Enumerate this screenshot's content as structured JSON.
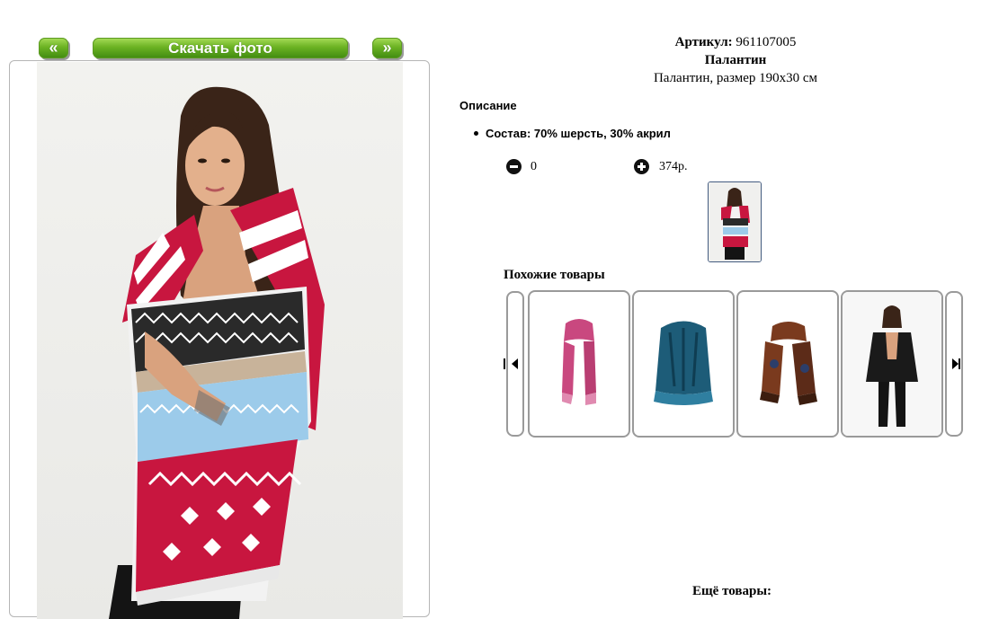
{
  "nav": {
    "prev_label": "«",
    "download_label": "Скачать фото",
    "next_label": "»"
  },
  "product": {
    "article_label": "Артикул:",
    "article_value": "961107005",
    "name": "Палантин",
    "subtitle": "Палантин, размер 190x30 см"
  },
  "description": {
    "title": "Описание",
    "items": [
      "Состав: 70% шерсть, 30% акрил"
    ]
  },
  "cart": {
    "quantity": "0",
    "price": "374р."
  },
  "similar": {
    "title": "Похожие товары",
    "items": [
      {
        "icon": "pink-scarf-image",
        "color": "#c9487f"
      },
      {
        "icon": "teal-scarf-image",
        "color": "#1d5c78"
      },
      {
        "icon": "brown-paisley-scarf-image",
        "color": "#7a3a1e"
      },
      {
        "icon": "black-cardigan-model-image",
        "color": "#1a1a1a"
      }
    ]
  },
  "more": {
    "title": "Ещё товары:"
  },
  "colors": {
    "button_green": "#6cb323",
    "scarf_red": "#c8163f",
    "scarf_blue": "#9ccbea"
  }
}
